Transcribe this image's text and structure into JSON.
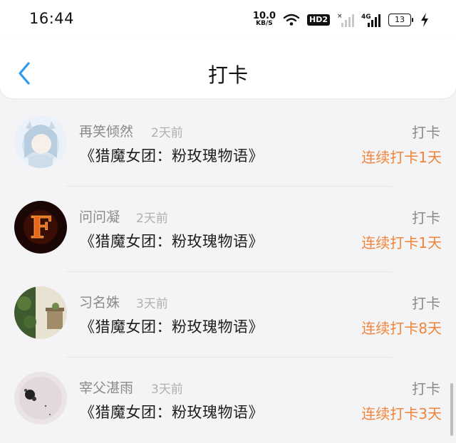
{
  "status_bar": {
    "time": "16:44",
    "net_speed_value": "10.0",
    "net_speed_unit": "KB/S",
    "hd_badge": "HD2",
    "network_type": "4G",
    "battery": "13"
  },
  "header": {
    "title": "打卡",
    "back_icon": "chevron-left-icon"
  },
  "items": [
    {
      "name": "再笑倾然",
      "time_ago": "2天前",
      "book": "《猎魔女团：粉玫瑰物语》",
      "action": "打卡",
      "streak": "连续打卡1天"
    },
    {
      "name": "问问凝",
      "time_ago": "2天前",
      "book": "《猎魔女团：粉玫瑰物语》",
      "action": "打卡",
      "streak": "连续打卡1天"
    },
    {
      "name": "习名姝",
      "time_ago": "3天前",
      "book": "《猎魔女团：粉玫瑰物语》",
      "action": "打卡",
      "streak": "连续打卡8天"
    },
    {
      "name": "宰父湛雨",
      "time_ago": "3天前",
      "book": "《猎魔女团：粉玫瑰物语》",
      "action": "打卡",
      "streak": "连续打卡3天"
    }
  ],
  "colors": {
    "accent_blue": "#2d9bf0",
    "streak_orange": "#f0843a",
    "background": "#f4f4f6"
  }
}
